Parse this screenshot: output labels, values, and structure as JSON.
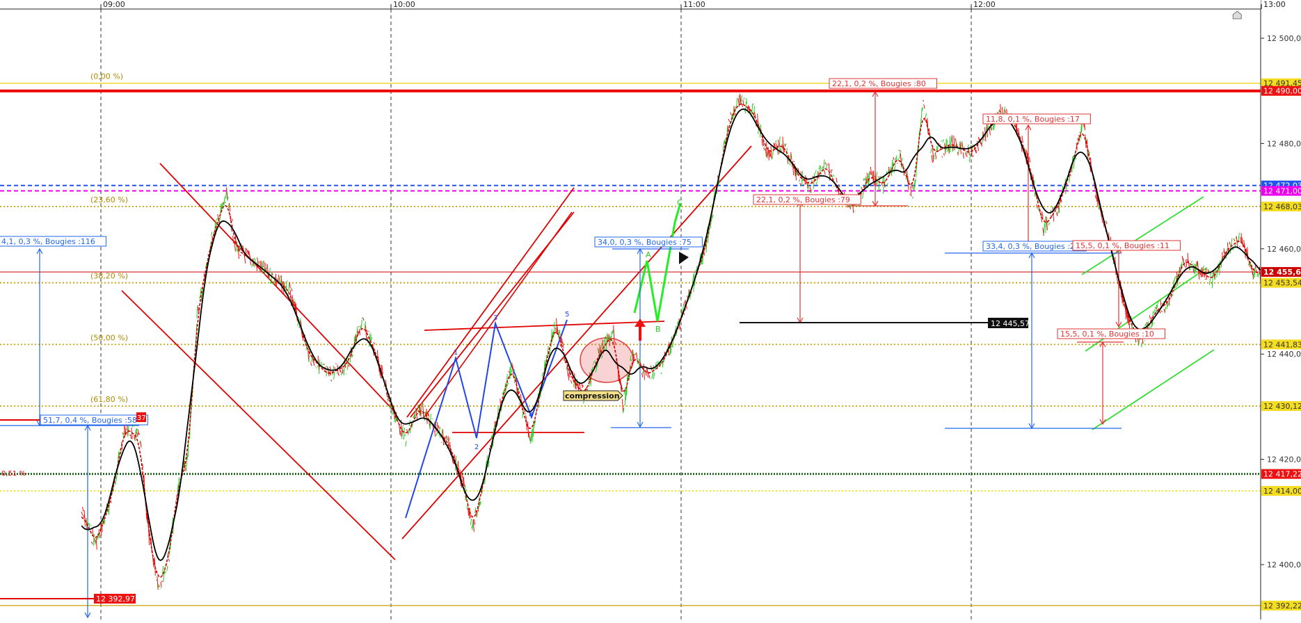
{
  "chart_data": {
    "type": "line",
    "instrument_scale": "price",
    "ylim": [
      12388,
      12507
    ],
    "x_axis": {
      "time_labels": [
        "09:00",
        "10:00",
        "11:00",
        "12:00",
        "13:00"
      ],
      "range": [
        "08:56",
        "13:01"
      ]
    },
    "y_axis_ticks": [
      "12 500,00",
      "12 480,00",
      "12 460,00",
      "12 440,00",
      "12 420,00",
      "12 400,00"
    ],
    "y_tick_values": [
      12500,
      12480,
      12460,
      12440,
      12420,
      12400
    ],
    "grid": "vertical dashed at hours",
    "price_line": {
      "color_up": "#22cc22",
      "color_down": "#ee1111",
      "approx_path": [
        [
          "08:56",
          12410
        ],
        [
          "08:59",
          12404
        ],
        [
          "09:02",
          12412
        ],
        [
          "09:05",
          12426
        ],
        [
          "09:08",
          12424
        ],
        [
          "09:10",
          12405
        ],
        [
          "09:12",
          12396
        ],
        [
          "09:14",
          12401
        ],
        [
          "09:16",
          12415
        ],
        [
          "09:18",
          12420
        ],
        [
          "09:20",
          12448
        ],
        [
          "09:23",
          12462
        ],
        [
          "09:26",
          12470
        ],
        [
          "09:28",
          12460
        ],
        [
          "09:31",
          12458
        ],
        [
          "09:35",
          12455
        ],
        [
          "09:39",
          12452
        ],
        [
          "09:43",
          12440
        ],
        [
          "09:47",
          12436
        ],
        [
          "09:51",
          12438
        ],
        [
          "09:54",
          12446
        ],
        [
          "09:57",
          12440
        ],
        [
          "10:00",
          12430
        ],
        [
          "10:03",
          12424
        ],
        [
          "10:06",
          12430
        ],
        [
          "10:09",
          12426
        ],
        [
          "10:12",
          12423
        ],
        [
          "10:15",
          12415
        ],
        [
          "10:17",
          12407
        ],
        [
          "10:19",
          12415
        ],
        [
          "10:22",
          12428
        ],
        [
          "10:25",
          12438
        ],
        [
          "10:27",
          12430
        ],
        [
          "10:29",
          12424
        ],
        [
          "10:32",
          12438
        ],
        [
          "10:34",
          12446
        ],
        [
          "10:37",
          12436
        ],
        [
          "10:40",
          12432
        ],
        [
          "10:43",
          12440
        ],
        [
          "10:46",
          12444
        ],
        [
          "10:48",
          12430
        ],
        [
          "10:50",
          12440
        ],
        [
          "10:53",
          12436
        ],
        [
          "10:56",
          12438
        ],
        [
          "10:59",
          12444
        ],
        [
          "11:02",
          12452
        ],
        [
          "11:05",
          12460
        ],
        [
          "11:07",
          12470
        ],
        [
          "11:10",
          12484
        ],
        [
          "11:12",
          12488
        ],
        [
          "11:15",
          12486
        ],
        [
          "11:18",
          12478
        ],
        [
          "11:21",
          12480
        ],
        [
          "11:24",
          12474
        ],
        [
          "11:27",
          12472
        ],
        [
          "11:30",
          12476
        ],
        [
          "11:33",
          12470
        ],
        [
          "11:36",
          12468
        ],
        [
          "11:39",
          12474
        ],
        [
          "11:42",
          12472
        ],
        [
          "11:45",
          12478
        ],
        [
          "11:48",
          12470
        ],
        [
          "11:50",
          12488
        ],
        [
          "11:52",
          12478
        ],
        [
          "11:56",
          12480
        ],
        [
          "12:00",
          12478
        ],
        [
          "12:03",
          12482
        ],
        [
          "12:06",
          12486
        ],
        [
          "12:09",
          12484
        ],
        [
          "12:12",
          12476
        ],
        [
          "12:15",
          12464
        ],
        [
          "12:18",
          12468
        ],
        [
          "12:21",
          12476
        ],
        [
          "12:23",
          12484
        ],
        [
          "12:26",
          12470
        ],
        [
          "12:29",
          12460
        ],
        [
          "12:32",
          12448
        ],
        [
          "12:35",
          12442
        ],
        [
          "12:38",
          12448
        ],
        [
          "12:41",
          12450
        ],
        [
          "12:44",
          12458
        ],
        [
          "12:47",
          12456
        ],
        [
          "12:50",
          12454
        ],
        [
          "12:53",
          12460
        ],
        [
          "12:56",
          12462
        ],
        [
          "12:58",
          12456
        ],
        [
          "13:00",
          12455
        ]
      ]
    },
    "moving_averages": [
      {
        "color": "#000000",
        "style": "solid"
      },
      {
        "color": "#cc0000",
        "style": "dashed"
      }
    ],
    "horizontal_levels": [
      {
        "value": 12491.45,
        "label": "12 491,45",
        "color": "#f0d000",
        "style": "solid"
      },
      {
        "value": 12490.0,
        "label": "12 490,00",
        "color": "#ee0000",
        "style": "solid-thick"
      },
      {
        "value": 12472.03,
        "label": "12 472,03",
        "color": "#2255ee",
        "style": "dashed"
      },
      {
        "value": 12471.0,
        "label": "12 471,00",
        "color": "#ee00ee",
        "style": "dashed"
      },
      {
        "value": 12468.03,
        "label": "12 468,03",
        "color": "#c8a000",
        "style": "dotted"
      },
      {
        "value": 12455.6,
        "label": "12 455,60",
        "color": "#cc0000",
        "style": "solid-thin"
      },
      {
        "value": 12453.54,
        "label": "12 453,54",
        "color": "#c8a000",
        "style": "dotted"
      },
      {
        "value": 12441.83,
        "label": "12 441,83",
        "color": "#c8a000",
        "style": "dotted"
      },
      {
        "value": 12430.12,
        "label": "12 430,12",
        "color": "#c8a000",
        "style": "dotted"
      },
      {
        "value": 12417.22,
        "label": "12 417,22",
        "color": "#226622",
        "style": "dotted-thick"
      },
      {
        "value": 12414.0,
        "label": "12 414,00",
        "color": "#f0e000",
        "style": "dotted"
      },
      {
        "value": 12392.22,
        "label": "12 392,22",
        "color": "#c8a000",
        "style": "solid"
      }
    ],
    "fibonacci_labels": [
      "(0,00 %)",
      "(23,60 %)",
      "(38,20 %)",
      "(50,00 %)",
      "(61,80 %)"
    ],
    "annotations": [
      "4,1, 0,3 %, Bougies :116",
      "51,7, 0,4 %, Bougies :58",
      "12 392,97",
      "34,0, 0,3 %, Bougies :75",
      "22,1, 0,2 %, Bougies :80",
      "22,1, 0,2 %, Bougies :79",
      "11,8, 0,1 %, Bougies :17",
      "33,4, 0,3 %, Bougies :2",
      "15,5, 0,1 %, Bougies :11",
      "15,5, 0,1 %, Bougies :10",
      "12 445,57",
      "compression",
      "37",
      "0,51 %"
    ],
    "wave_labels": [
      "1",
      "2",
      "3",
      "4",
      "5"
    ],
    "abc_labels": [
      "A",
      "B",
      "C"
    ],
    "current_price": "12 455,60"
  }
}
